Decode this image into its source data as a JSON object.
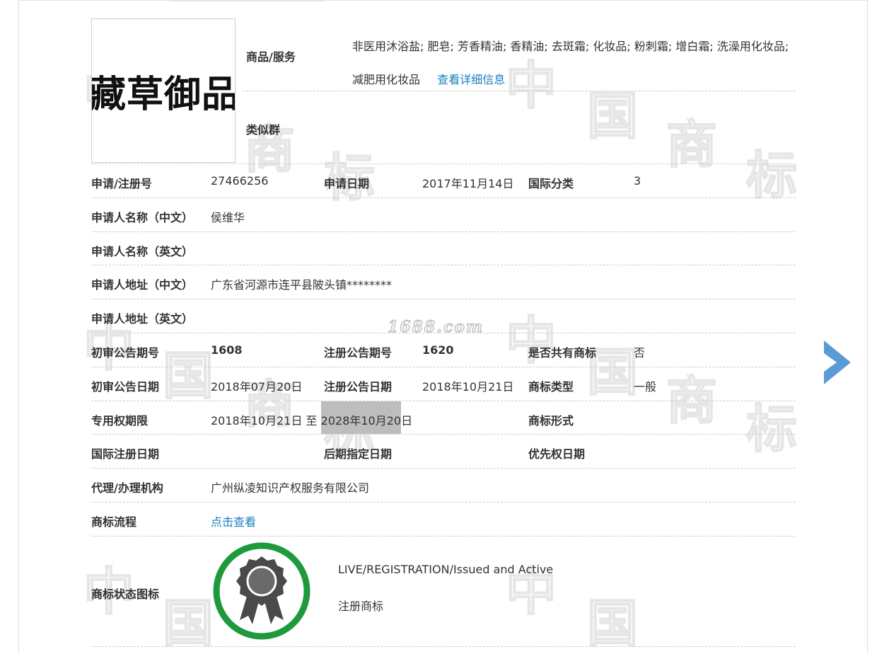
{
  "logo": {
    "text": "藏草御品"
  },
  "goods": {
    "label": "商品/服务",
    "items_text": "非医用沐浴盐; 肥皂; 芳香精油; 香精油; 去斑霜; 化妆品; 粉刺霜; 增白霜; 洗澡用化妆品; 减肥用化妆品",
    "detail_link": "查看详细信息"
  },
  "similar_group": {
    "label": "类似群"
  },
  "registration": {
    "number_label": "申请/注册号",
    "number": "27466256",
    "date_label": "申请日期",
    "date": "2017年11月14日",
    "class_label": "国际分类",
    "class": "3"
  },
  "applicant": {
    "name_cn_label": "申请人名称（中文）",
    "name_cn": "侯维华",
    "name_en_label": "申请人名称（英文）",
    "name_en": "",
    "address_cn_label": "申请人地址（中文）",
    "address_cn": "广东省河源市连平县陂头镇********",
    "address_en_label": "申请人地址（英文）",
    "address_en": ""
  },
  "announcement": {
    "prelim_no_label": "初审公告期号",
    "prelim_no": "1608",
    "reg_no_label": "注册公告期号",
    "reg_no": "1620",
    "shared_label": "是否共有商标",
    "shared": "否",
    "prelim_date_label": "初审公告日期",
    "prelim_date": "2018年07月20日",
    "reg_date_label": "注册公告日期",
    "reg_date": "2018年10月21日",
    "type_label": "商标类型",
    "type": "一般"
  },
  "rights": {
    "period_label": "专用权期限",
    "period_start": "2018年10月21日",
    "period_sep": "至",
    "period_end": "2028年10月20日",
    "form_label": "商标形式",
    "form": ""
  },
  "dates": {
    "intl_reg_label": "国际注册日期",
    "intl_reg": "",
    "later_designation_label": "后期指定日期",
    "later_designation": "",
    "priority_label": "优先权日期",
    "priority": ""
  },
  "agent": {
    "label": "代理/办理机构",
    "name": "广州纵凌知识产权服务有限公司"
  },
  "process": {
    "label": "商标流程",
    "link": "点击查看"
  },
  "status": {
    "label": "商标状态图标",
    "en": "LIVE/REGISTRATION/Issued and Active",
    "cn": "注册商标",
    "ring_color": "#1e9a3c",
    "medal_color": "#4a4a4a"
  },
  "watermarks": {
    "site": "1688.com",
    "glyph_zhong": "中",
    "glyph_guo": "国",
    "glyph_shang": "商",
    "glyph_biao": "标"
  },
  "nav": {
    "prev_color": "#ff8a00",
    "next_color": "#5b9bd5"
  }
}
